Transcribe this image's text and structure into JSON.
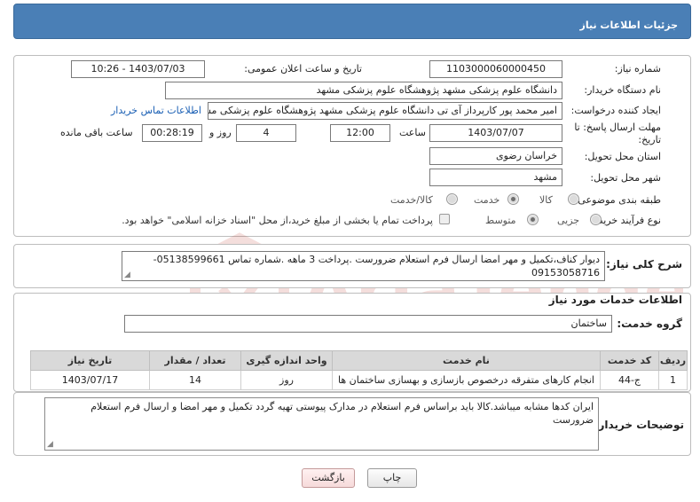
{
  "header": {
    "title": "جزئیات اطلاعات نیاز"
  },
  "form": {
    "need_number": {
      "label": "شماره نیاز:",
      "value": "1103000060000450"
    },
    "announce": {
      "label": "تاریخ و ساعت اعلان عمومی:",
      "value": "1403/07/03 - 10:26"
    },
    "buyer_org": {
      "label": "نام دستگاه خریدار:",
      "value": "دانشگاه علوم پزشکی مشهد    پژوهشگاه علوم پزشکی مشهد"
    },
    "requester": {
      "label": "ایجاد کننده درخواست:",
      "value": "امیر محمد پور کارپرداز آی تی دانشگاه علوم پزشکی مشهد    پژوهشگاه علوم پزشکی مشهد",
      "contact_link": "اطلاعات تماس خریدار"
    },
    "deadline": {
      "label": "مهلت ارسال پاسخ: تا تاریخ:",
      "date": "1403/07/07",
      "time_label": "ساعت",
      "time": "12:00",
      "days": "4",
      "days_label": "روز و",
      "remaining": "00:28:19",
      "remaining_label": "ساعت باقی مانده"
    },
    "province": {
      "label": "استان محل تحویل:",
      "value": "خراسان رضوی"
    },
    "city": {
      "label": "شهر محل تحویل:",
      "value": "مشهد"
    },
    "category": {
      "label": "طبقه بندی موضوعی:",
      "options": [
        "کالا",
        "خدمت",
        "کالا/خدمت"
      ],
      "selected": "خدمت"
    },
    "process": {
      "label": "نوع فرآیند خرید :",
      "options": [
        "جزیی",
        "متوسط"
      ],
      "selected": "متوسط",
      "treasury_note": "پرداخت تمام یا بخشی از مبلغ خرید،از محل \"اسناد خزانه اسلامی\" خواهد بود."
    }
  },
  "summary": {
    "label": "شرح کلی نیاز:",
    "text": "دیوار کناف،تکمیل و مهر امضا ارسال فرم استعلام ضرورست .پرداخت 3 ماهه .شماره تماس 05138599661-09153058716"
  },
  "services": {
    "section_title": "اطلاعات خدمات مورد نیاز",
    "group_label": "گروه خدمت:",
    "group_value": "ساختمان",
    "columns": [
      "ردیف",
      "کد خدمت",
      "نام خدمت",
      "واحد اندازه گیری",
      "تعداد / مقدار",
      "تاریخ نیاز"
    ],
    "rows": [
      [
        "1",
        "ج-44",
        "انجام کارهای متفرقه درخصوص بازسازی و بهسازی ساختمان ها",
        "روز",
        "14",
        "1403/07/17"
      ]
    ]
  },
  "buyer_notes": {
    "label": "توضیحات خریدار:",
    "text": "ایران کدها مشابه میباشد.کالا باید براساس فرم استعلام در مدارک پیوستی تهیه گردد تکمیل و مهر امضا و ارسال فرم استعلام ضرورست"
  },
  "buttons": {
    "print": "چاپ",
    "back": "بازگشت"
  },
  "watermark": {
    "text": "AriaTender.net"
  },
  "colors": {
    "header": "#4a7fb6",
    "link": "#1a5fb4",
    "watermark": "#c0392b"
  }
}
